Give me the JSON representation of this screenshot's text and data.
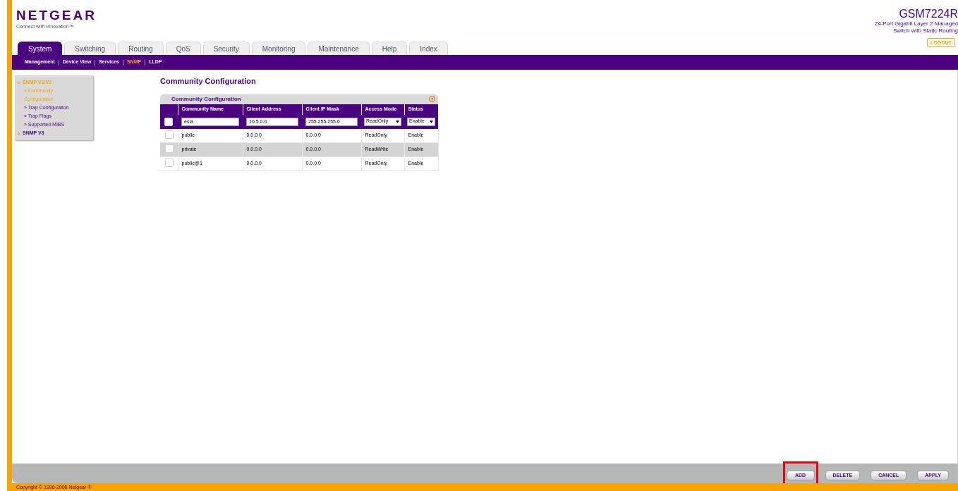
{
  "brand": {
    "logo": "NETGEAR",
    "tagline": "Connect with Innovation™"
  },
  "product": {
    "model": "GSM7224R",
    "description": "24-Port Gigabit Layer 2 Managed Switch with Static Routing"
  },
  "logout": "LOGOUT",
  "tabs": [
    {
      "label": "System",
      "selected": true
    },
    {
      "label": "Switching",
      "selected": false
    },
    {
      "label": "Routing",
      "selected": false
    },
    {
      "label": "QoS",
      "selected": false
    },
    {
      "label": "Security",
      "selected": false
    },
    {
      "label": "Monitoring",
      "selected": false
    },
    {
      "label": "Maintenance",
      "selected": false
    },
    {
      "label": "Help",
      "selected": false
    },
    {
      "label": "Index",
      "selected": false
    }
  ],
  "subnav": [
    {
      "label": "Management",
      "selected": false
    },
    {
      "label": "Device View",
      "selected": false
    },
    {
      "label": "Services",
      "selected": false
    },
    {
      "label": "SNMP",
      "selected": true
    },
    {
      "label": "LLDP",
      "selected": false
    }
  ],
  "sidebar": {
    "items": [
      {
        "label": "SNMP V1/V2",
        "expanded": true,
        "children": [
          {
            "label": "» Community Configuration",
            "selected": true
          },
          {
            "label": "» Trap Configuration",
            "selected": false
          },
          {
            "label": "» Trap Flags",
            "selected": false
          },
          {
            "label": "» Supported MIBS",
            "selected": false
          }
        ]
      },
      {
        "label": "SNMP V3",
        "expanded": false
      }
    ]
  },
  "page_title": "Community Configuration",
  "panel": {
    "title": "Community Configuration",
    "help": "?",
    "table": {
      "columns": [
        "Community Name",
        "Client Address",
        "Client IP Mask",
        "Access Mode",
        "Status"
      ],
      "input_row": {
        "checked": false,
        "name": "esia",
        "address": "10.5.0.0",
        "mask": "255.255.255.0",
        "access_mode": "ReadOnly",
        "status": "Enable"
      },
      "rows": [
        {
          "checked": false,
          "selected": false,
          "cells": [
            "public",
            "0.0.0.0",
            "0.0.0.0",
            "ReadOnly",
            "Enable"
          ]
        },
        {
          "checked": false,
          "selected": true,
          "cells": [
            "private",
            "0.0.0.0",
            "0.0.0.0",
            "ReadWrite",
            "Enable"
          ]
        },
        {
          "checked": false,
          "selected": false,
          "cells": [
            "public@1",
            "0.0.0.0",
            "0.0.0.0",
            "ReadOnly",
            "Enable"
          ]
        }
      ]
    }
  },
  "buttons": [
    {
      "label": "ADD",
      "highlighted": true
    },
    {
      "label": "DELETE",
      "highlighted": false
    },
    {
      "label": "CANCEL",
      "highlighted": false
    },
    {
      "label": "APPLY",
      "highlighted": false
    }
  ],
  "footer": "Copyright © 1996-2008 Netgear ®"
}
